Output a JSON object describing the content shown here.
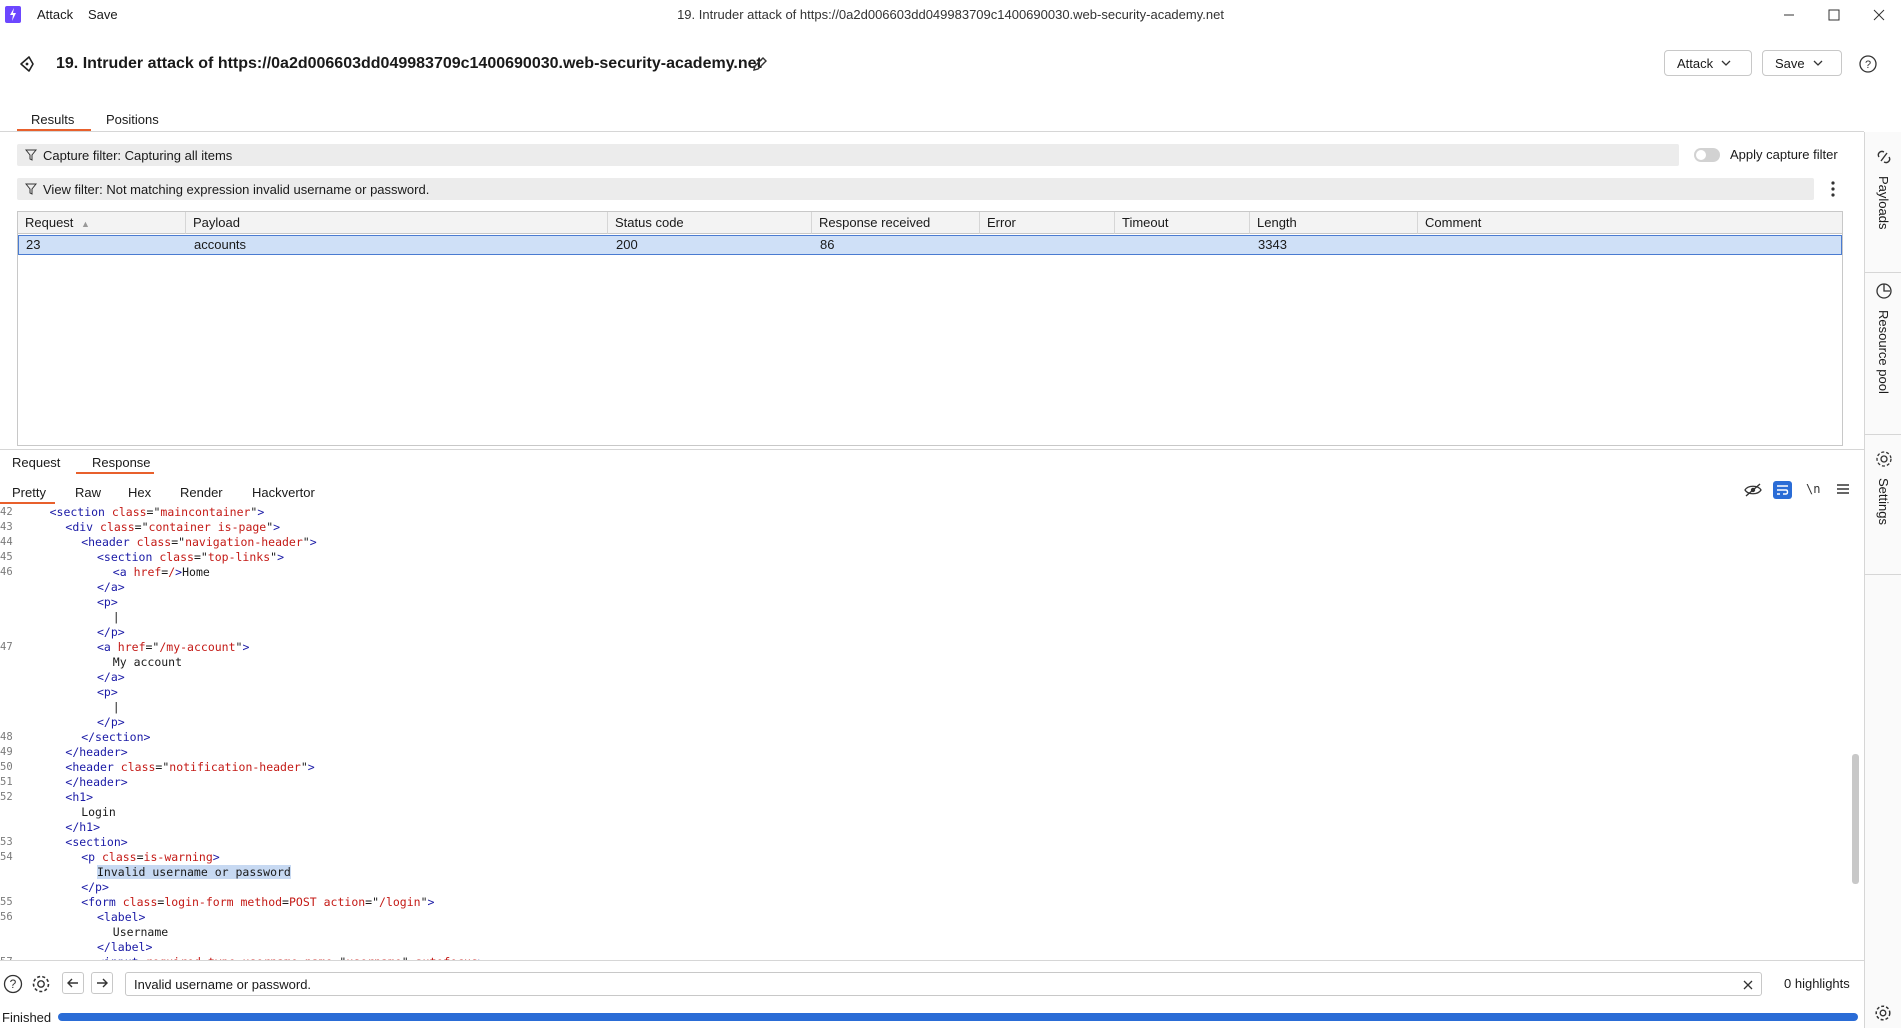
{
  "window": {
    "menu": [
      "Attack",
      "Save"
    ],
    "title": "19. Intruder attack of https://0a2d006603dd049983709c1400690030.web-security-academy.net"
  },
  "header": {
    "title": "19. Intruder attack of https://0a2d006603dd049983709c1400690030.web-security-academy.net",
    "attack_button": "Attack",
    "save_button": "Save"
  },
  "tabs": [
    {
      "label": "Results",
      "active": true
    },
    {
      "label": "Positions",
      "active": false
    }
  ],
  "capture_filter": {
    "text": "Capture filter: Capturing all items",
    "toggle_label": "Apply capture filter",
    "toggle_on": false
  },
  "view_filter": {
    "text": "View filter: Not matching expression invalid username or password."
  },
  "table": {
    "columns": [
      "Request",
      "Payload",
      "Status code",
      "Response received",
      "Error",
      "Timeout",
      "Length",
      "Comment"
    ],
    "rows": [
      [
        "23",
        "accounts",
        "200",
        "86",
        "",
        "",
        "3343",
        ""
      ]
    ]
  },
  "right_rail": [
    "Payloads",
    "Resource pool",
    "Settings"
  ],
  "message_tabs": [
    {
      "label": "Request",
      "active": false
    },
    {
      "label": "Response",
      "active": true
    }
  ],
  "view_tabs": [
    {
      "label": "Pretty",
      "active": true
    },
    {
      "label": "Raw",
      "active": false
    },
    {
      "label": "Hex",
      "active": false
    },
    {
      "label": "Render",
      "active": false
    },
    {
      "label": "Hackvertor",
      "active": false
    }
  ],
  "code_lines": [
    {
      "n": "42",
      "indent": 4,
      "html": "<span class=\"tag\">&lt;section</span> <span class=\"attr\">class</span>=\"<span class=\"val\">maincontainer</span>\"<span class=\"tag\">&gt;</span>"
    },
    {
      "n": "43",
      "indent": 6,
      "html": "<span class=\"tag\">&lt;div</span> <span class=\"attr\">class</span>=\"<span class=\"val\">container is-page</span>\"<span class=\"tag\">&gt;</span>"
    },
    {
      "n": "44",
      "indent": 8,
      "html": "<span class=\"tag\">&lt;header</span> <span class=\"attr\">class</span>=\"<span class=\"val\">navigation-header</span>\"<span class=\"tag\">&gt;</span>"
    },
    {
      "n": "45",
      "indent": 10,
      "html": "<span class=\"tag\">&lt;section</span> <span class=\"attr\">class</span>=\"<span class=\"val\">top-links</span>\"<span class=\"tag\">&gt;</span>"
    },
    {
      "n": "46",
      "indent": 12,
      "html": "<span class=\"tag\">&lt;a</span> <span class=\"attr\">href</span>=<span class=\"val\">/</span><span class=\"tag\">&gt;</span>Home"
    },
    {
      "n": "",
      "indent": 10,
      "html": "<span class=\"tag\">&lt;/a&gt;</span>"
    },
    {
      "n": "",
      "indent": 10,
      "html": "<span class=\"tag\">&lt;p&gt;</span>"
    },
    {
      "n": "",
      "indent": 12,
      "html": "|"
    },
    {
      "n": "",
      "indent": 10,
      "html": "<span class=\"tag\">&lt;/p&gt;</span>"
    },
    {
      "n": "47",
      "indent": 10,
      "html": "<span class=\"tag\">&lt;a</span> <span class=\"attr\">href</span>=\"<span class=\"val\">/my-account</span>\"<span class=\"tag\">&gt;</span>"
    },
    {
      "n": "",
      "indent": 12,
      "html": "My account"
    },
    {
      "n": "",
      "indent": 10,
      "html": "<span class=\"tag\">&lt;/a&gt;</span>"
    },
    {
      "n": "",
      "indent": 10,
      "html": "<span class=\"tag\">&lt;p&gt;</span>"
    },
    {
      "n": "",
      "indent": 12,
      "html": "|"
    },
    {
      "n": "",
      "indent": 10,
      "html": "<span class=\"tag\">&lt;/p&gt;</span>"
    },
    {
      "n": "48",
      "indent": 8,
      "html": "<span class=\"tag\">&lt;/section&gt;</span>"
    },
    {
      "n": "49",
      "indent": 6,
      "html": "<span class=\"tag\">&lt;/header&gt;</span>"
    },
    {
      "n": "50",
      "indent": 6,
      "html": "<span class=\"tag\">&lt;header</span> <span class=\"attr\">class</span>=\"<span class=\"val\">notification-header</span>\"<span class=\"tag\">&gt;</span>"
    },
    {
      "n": "51",
      "indent": 6,
      "html": "<span class=\"tag\">&lt;/header&gt;</span>"
    },
    {
      "n": "52",
      "indent": 6,
      "html": "<span class=\"tag\">&lt;h1&gt;</span>"
    },
    {
      "n": "",
      "indent": 8,
      "html": "Login"
    },
    {
      "n": "",
      "indent": 6,
      "html": "<span class=\"tag\">&lt;/h1&gt;</span>"
    },
    {
      "n": "53",
      "indent": 6,
      "html": "<span class=\"tag\">&lt;section&gt;</span>"
    },
    {
      "n": "54",
      "indent": 8,
      "html": "<span class=\"tag\">&lt;p</span> <span class=\"attr\">class</span>=<span class=\"val\">is-warning</span><span class=\"tag\">&gt;</span>"
    },
    {
      "n": "",
      "indent": 10,
      "html": "<span class=\"hl\">Invalid username or password</span>"
    },
    {
      "n": "",
      "indent": 8,
      "html": "<span class=\"tag\">&lt;/p&gt;</span>"
    },
    {
      "n": "55",
      "indent": 8,
      "html": "<span class=\"tag\">&lt;form</span> <span class=\"attr\">class</span>=<span class=\"val\">login-form</span> <span class=\"attr\">method</span>=<span class=\"val\">POST</span> <span class=\"attr\">action</span>=\"<span class=\"val\">/login</span>\"<span class=\"tag\">&gt;</span>"
    },
    {
      "n": "56",
      "indent": 10,
      "html": "<span class=\"tag\">&lt;label&gt;</span>"
    },
    {
      "n": "",
      "indent": 12,
      "html": "Username"
    },
    {
      "n": "",
      "indent": 10,
      "html": "<span class=\"tag\">&lt;/label&gt;</span>"
    },
    {
      "n": "57",
      "indent": 10,
      "html": "<span class=\"tag\">&lt;input</span> <span class=\"attr\">required</span> <span class=\"attr\">type</span>=<span class=\"val\">username</span> <span class=\"attr\">name</span>=\"<span class=\"val\">username</span>\" <span class=\"attr\">autofocus</span><span class=\"tag\">&gt;</span>"
    }
  ],
  "search": {
    "value": "Invalid username or password.",
    "highlights": "0 highlights"
  },
  "status": {
    "text": "Finished",
    "progress": 1.0
  }
}
